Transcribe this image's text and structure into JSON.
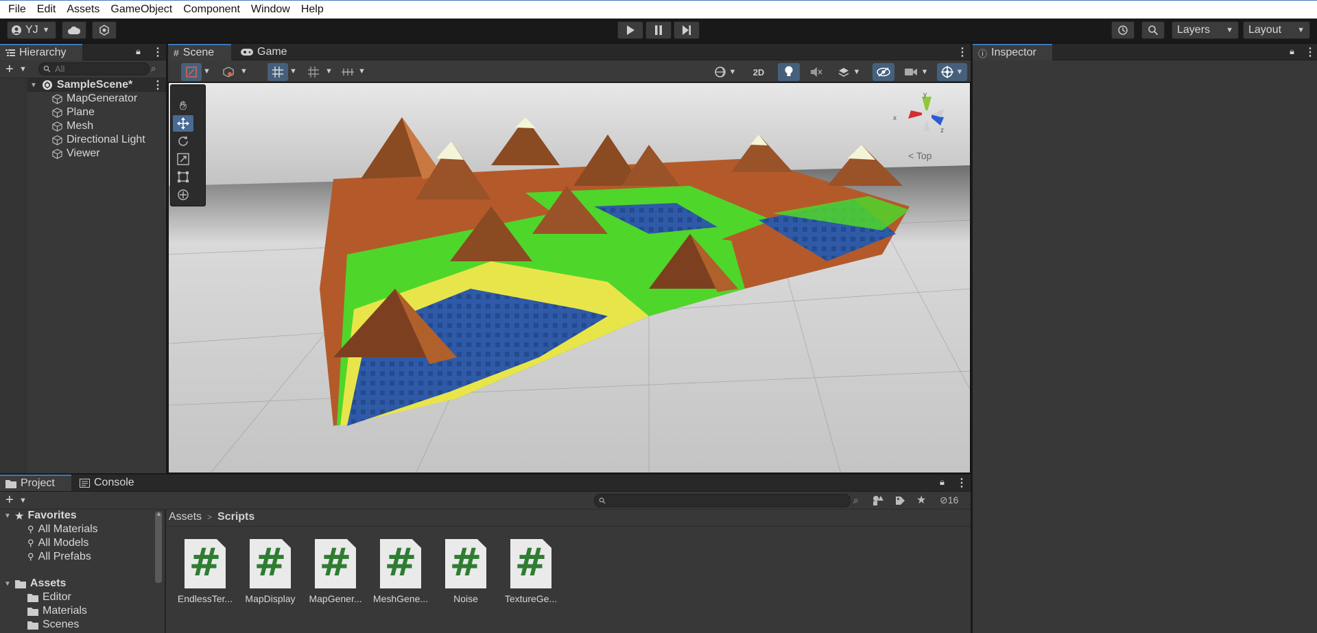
{
  "menu": [
    "File",
    "Edit",
    "Assets",
    "GameObject",
    "Component",
    "Window",
    "Help"
  ],
  "toolbar": {
    "account": "YJ",
    "layers": "Layers",
    "layout": "Layout"
  },
  "hierarchy": {
    "tab": "Hierarchy",
    "search_placeholder": "All",
    "scene": "SampleScene*",
    "items": [
      "MapGenerator",
      "Plane",
      "Mesh",
      "Directional Light",
      "Viewer"
    ]
  },
  "scene": {
    "tab_scene": "Scene",
    "tab_game": "Game",
    "btn_2d": "2D",
    "gizmo": {
      "y": "y",
      "x": "x",
      "z": "z",
      "view": "Top"
    }
  },
  "inspector": {
    "tab": "Inspector"
  },
  "project": {
    "tab_project": "Project",
    "tab_console": "Console",
    "hidden_count": "16",
    "favorites": {
      "label": "Favorites",
      "items": [
        "All Materials",
        "All Models",
        "All Prefabs"
      ]
    },
    "assets": {
      "label": "Assets",
      "items": [
        "Editor",
        "Materials",
        "Scenes"
      ]
    },
    "breadcrumb": {
      "root": "Assets",
      "current": "Scripts"
    },
    "files": [
      "EndlessTer...",
      "MapDisplay",
      "MapGener...",
      "MeshGene...",
      "Noise",
      "TextureGe..."
    ]
  },
  "colors": {
    "accent": "#3a79bb",
    "script_icon": "#2e7d32",
    "terrain_water": "#2f5aa8",
    "terrain_grass": "#4fd62a",
    "terrain_sand": "#e8e54a",
    "terrain_rock": "#b45a2a",
    "terrain_snow": "#f4f4d8"
  }
}
